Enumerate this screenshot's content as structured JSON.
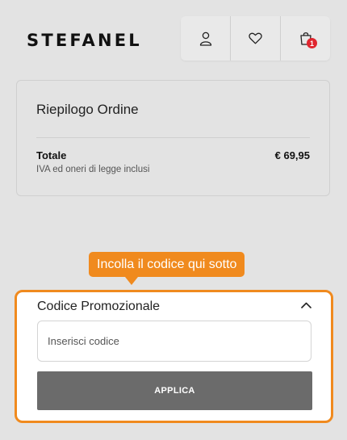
{
  "header": {
    "logo_text": "STEFANEL",
    "actions": [
      {
        "icon": "user-icon"
      },
      {
        "icon": "heart-icon"
      },
      {
        "icon": "shopping-bag-icon",
        "badge": "1"
      }
    ]
  },
  "summary": {
    "title": "Riepilogo Ordine",
    "total_label": "Totale",
    "total_value": "€ 69,95",
    "vat_note": "IVA ed oneri di legge inclusi"
  },
  "tooltip": {
    "text": "Incolla il codice qui sotto"
  },
  "promo": {
    "title": "Codice Promozionale",
    "input_placeholder": "Inserisci codice",
    "input_value": "",
    "apply_label": "APPLICA",
    "expanded": true
  },
  "colors": {
    "highlight": "#f08a1e",
    "badge": "#e0262f",
    "apply_button": "#6b6b6b",
    "background": "#e3e3e3"
  }
}
